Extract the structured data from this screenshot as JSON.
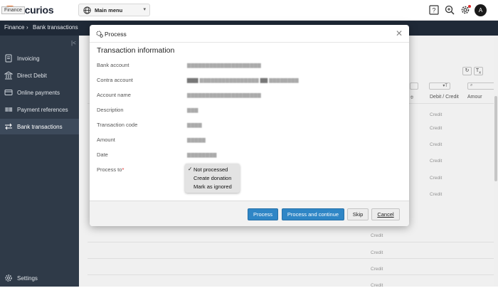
{
  "app": {
    "logo_text": "rocurios",
    "tooltip": "Finance",
    "main_menu_label": "Main menu",
    "avatar_initial": "A"
  },
  "breadcrumb": {
    "root": "Finance",
    "separator": "›",
    "current": "Bank transactions"
  },
  "sidebar": {
    "items": [
      {
        "label": "Invoicing",
        "icon": "invoice-icon"
      },
      {
        "label": "Direct Debit",
        "icon": "bank-icon"
      },
      {
        "label": "Online payments",
        "icon": "card-icon"
      },
      {
        "label": "Payment references",
        "icon": "barcode-icon"
      },
      {
        "label": "Bank transactions",
        "icon": "transfer-icon",
        "active": true
      }
    ],
    "settings_label": "Settings"
  },
  "table": {
    "headers": {
      "debit_credit": "Debit / Credit",
      "amount": "Amour"
    },
    "rows_credit": [
      "Credit",
      "Credit",
      "Credit",
      "Credit",
      "Credit",
      "Credit",
      "Credit",
      "Credit",
      "Credit",
      "Credit"
    ]
  },
  "modal": {
    "title": "Process",
    "section_title": "Transaction information",
    "fields": [
      {
        "label": "Bank account"
      },
      {
        "label": "Contra account"
      },
      {
        "label": "Account name"
      },
      {
        "label": "Description"
      },
      {
        "label": "Transaction code"
      },
      {
        "label": "Amount"
      },
      {
        "label": "Date"
      }
    ],
    "process_to_label": "Process to",
    "required_mark": "*",
    "options": [
      {
        "label": "Not processed",
        "selected": true
      },
      {
        "label": "Create donation",
        "selected": false
      },
      {
        "label": "Mark as ignored",
        "selected": false
      }
    ],
    "buttons": {
      "process": "Process",
      "process_continue": "Process and continue",
      "skip": "Skip",
      "cancel": "Cancel"
    }
  },
  "colors": {
    "accent": "#2f86c6",
    "sidebar_bg": "#2f3a48",
    "topstrip_bg": "#1f2937",
    "brand_orange": "#e8702a"
  }
}
